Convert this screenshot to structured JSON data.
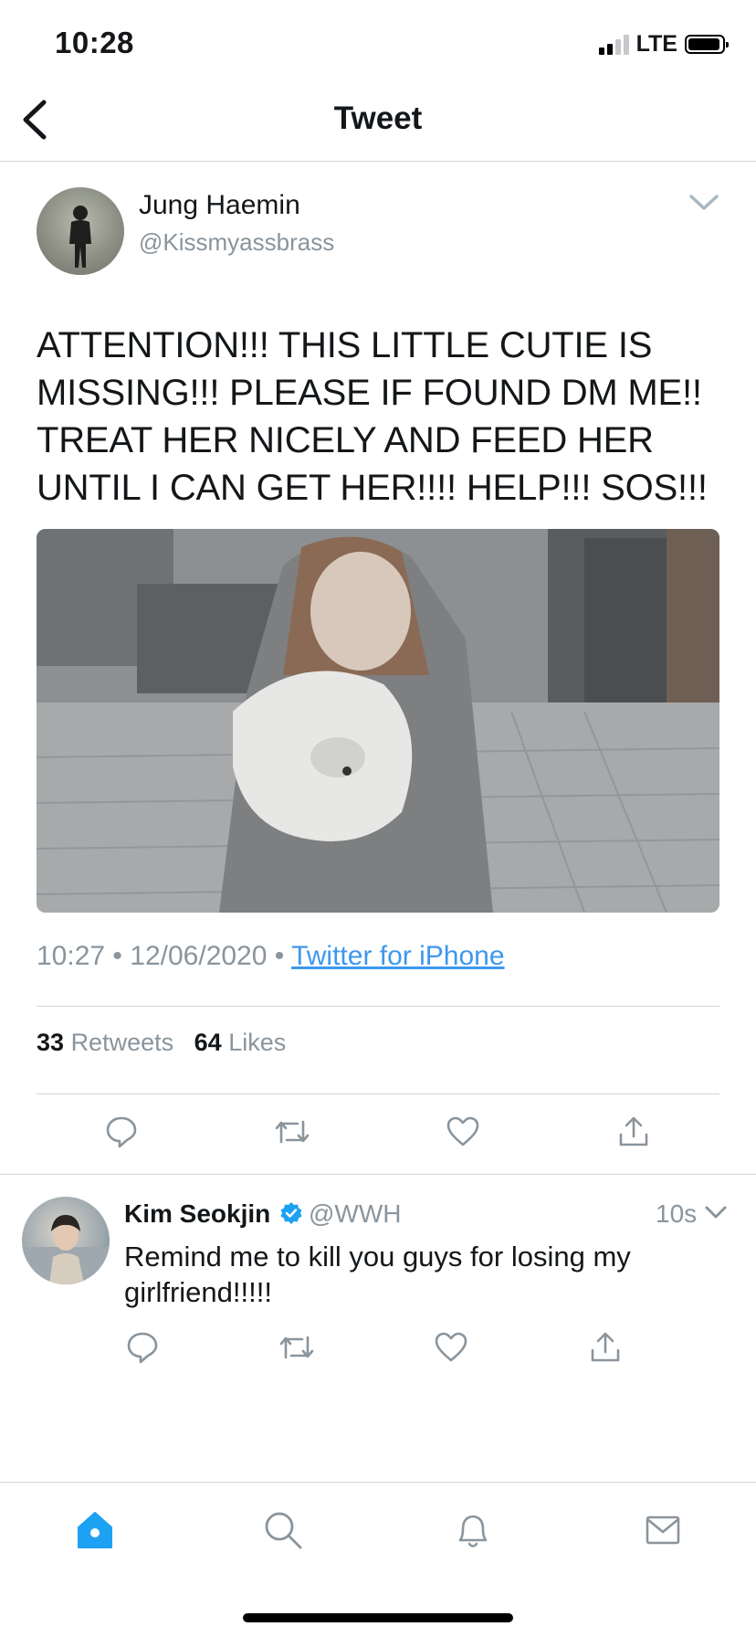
{
  "status_bar": {
    "time": "10:28",
    "network": "LTE"
  },
  "header": {
    "title": "Tweet"
  },
  "tweet": {
    "author_name": "Jung Haemin",
    "author_handle": "@Kissmyassbrass",
    "text": "ATTENTION!!! THIS LITTLE CUTIE IS MISSING!!! PLEASE IF FOUND DM ME!! TREAT HER NICELY AND FEED HER UNTIL I CAN GET HER!!!! HELP!!! SOS!!!",
    "time": "10:27",
    "date": "12/06/2020",
    "separator": "•",
    "source": "Twitter for iPhone",
    "retweet_count": "33",
    "retweet_label": "Retweets",
    "like_count": "64",
    "like_label": "Likes"
  },
  "reply": {
    "author_name": "Kim Seokjin",
    "author_handle": "@WWH",
    "time": "10s",
    "text": "Remind me to kill you guys for losing my girlfriend!!!!!"
  },
  "icons": {
    "back": "back-chevron-icon",
    "caret": "chevron-down-icon",
    "reply": "reply-icon",
    "retweet": "retweet-icon",
    "like": "heart-icon",
    "share": "share-icon",
    "verified": "verified-badge-icon",
    "tabs": [
      "home-icon",
      "search-icon",
      "bell-icon",
      "mail-icon"
    ]
  },
  "colors": {
    "accent": "#1da1f2",
    "link": "#3e97ee",
    "muted": "#8a949c",
    "text": "#14171a"
  }
}
